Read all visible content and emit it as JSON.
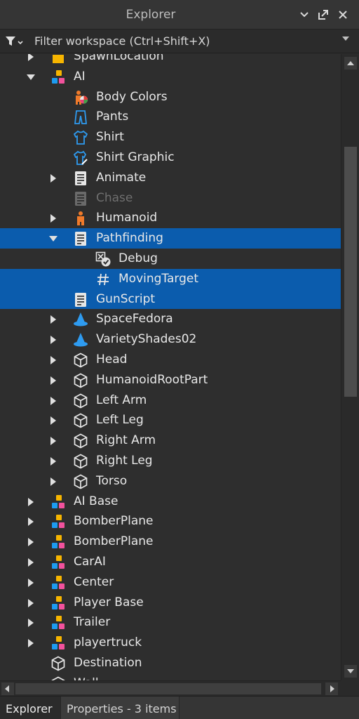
{
  "window": {
    "title": "Explorer"
  },
  "filter": {
    "placeholder": "Filter workspace (Ctrl+Shift+X)"
  },
  "tree": [
    {
      "label": "SpawnLocation",
      "icon": "spawn-icon",
      "arrow": "right",
      "depth": 1,
      "cut": true
    },
    {
      "label": "AI",
      "icon": "model-icon",
      "arrow": "down",
      "depth": 1
    },
    {
      "label": "Body Colors",
      "icon": "body-colors-icon",
      "arrow": "none",
      "depth": 2
    },
    {
      "label": "Pants",
      "icon": "pants-icon",
      "arrow": "none",
      "depth": 2
    },
    {
      "label": "Shirt",
      "icon": "shirt-icon",
      "arrow": "none",
      "depth": 2
    },
    {
      "label": "Shirt Graphic",
      "icon": "shirt-graphic-icon",
      "arrow": "none",
      "depth": 2
    },
    {
      "label": "Animate",
      "icon": "script-icon",
      "arrow": "right",
      "depth": 2
    },
    {
      "label": "Chase",
      "icon": "script-disabled-icon",
      "arrow": "none",
      "depth": 2,
      "dim": true
    },
    {
      "label": "Humanoid",
      "icon": "humanoid-icon",
      "arrow": "right",
      "depth": 2
    },
    {
      "label": "Pathfinding",
      "icon": "script-icon",
      "arrow": "down",
      "depth": 2,
      "selected": true
    },
    {
      "label": "Debug",
      "icon": "bool-value-icon",
      "arrow": "none",
      "depth": 3
    },
    {
      "label": "MovingTarget",
      "icon": "number-value-icon",
      "arrow": "none",
      "depth": 3,
      "selected": true
    },
    {
      "label": "GunScript",
      "icon": "script-icon",
      "arrow": "none",
      "depth": 2,
      "selected": true
    },
    {
      "label": "SpaceFedora",
      "icon": "accessory-hat-icon",
      "arrow": "right",
      "depth": 2
    },
    {
      "label": "VarietyShades02",
      "icon": "accessory-hat-icon",
      "arrow": "right",
      "depth": 2
    },
    {
      "label": "Head",
      "icon": "part-icon",
      "arrow": "right",
      "depth": 2
    },
    {
      "label": "HumanoidRootPart",
      "icon": "part-icon",
      "arrow": "right",
      "depth": 2
    },
    {
      "label": "Left Arm",
      "icon": "part-icon",
      "arrow": "right",
      "depth": 2
    },
    {
      "label": "Left Leg",
      "icon": "part-icon",
      "arrow": "right",
      "depth": 2
    },
    {
      "label": "Right Arm",
      "icon": "part-icon",
      "arrow": "right",
      "depth": 2
    },
    {
      "label": "Right Leg",
      "icon": "part-icon",
      "arrow": "right",
      "depth": 2
    },
    {
      "label": "Torso",
      "icon": "part-icon",
      "arrow": "right",
      "depth": 2
    },
    {
      "label": "AI Base",
      "icon": "model-icon",
      "arrow": "right",
      "depth": 1
    },
    {
      "label": "BomberPlane",
      "icon": "model-icon",
      "arrow": "right",
      "depth": 1
    },
    {
      "label": "BomberPlane",
      "icon": "model-icon",
      "arrow": "right",
      "depth": 1
    },
    {
      "label": "CarAI",
      "icon": "model-icon",
      "arrow": "right",
      "depth": 1
    },
    {
      "label": "Center",
      "icon": "model-icon",
      "arrow": "right",
      "depth": 1
    },
    {
      "label": "Player Base",
      "icon": "model-icon",
      "arrow": "right",
      "depth": 1
    },
    {
      "label": "Trailer",
      "icon": "model-icon",
      "arrow": "right",
      "depth": 1
    },
    {
      "label": "playertruck",
      "icon": "model-icon",
      "arrow": "right",
      "depth": 1
    },
    {
      "label": "Destination",
      "icon": "part-icon",
      "arrow": "none",
      "depth": 1
    },
    {
      "label": "Wall",
      "icon": "part-icon",
      "arrow": "none",
      "depth": 1
    }
  ],
  "tabs": [
    {
      "label": "Explorer",
      "active": true
    },
    {
      "label": "Properties - 3 items",
      "active": false
    }
  ],
  "colors": {
    "selection": "#0b5cad",
    "panel": "#2e2e2e",
    "model_yellow": "#f7b500",
    "model_blue": "#1d9bf0",
    "model_pink": "#f2529d"
  }
}
